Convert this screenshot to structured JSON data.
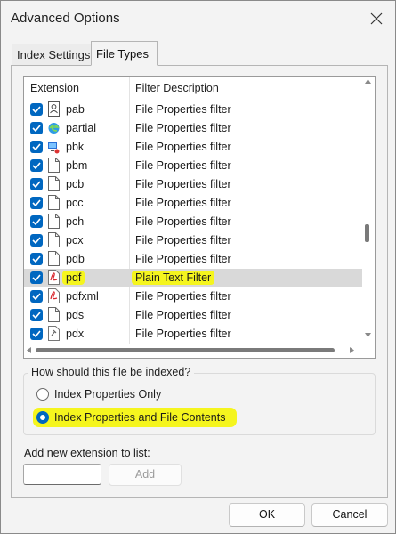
{
  "window": {
    "title": "Advanced Options"
  },
  "tabs": [
    {
      "label": "Index Settings",
      "active": false
    },
    {
      "label": "File Types",
      "active": true
    }
  ],
  "list": {
    "columns": {
      "extension": "Extension",
      "description": "Filter Description"
    },
    "rows": [
      {
        "ext": "pab",
        "desc": "File Properties filter",
        "icon": "contact-card-icon",
        "checked": true
      },
      {
        "ext": "partial",
        "desc": "File Properties filter",
        "icon": "edge-browser-icon",
        "checked": true
      },
      {
        "ext": "pbk",
        "desc": "File Properties filter",
        "icon": "network-phonebook-icon",
        "checked": true
      },
      {
        "ext": "pbm",
        "desc": "File Properties filter",
        "icon": "blank-file-icon",
        "checked": true
      },
      {
        "ext": "pcb",
        "desc": "File Properties filter",
        "icon": "blank-file-icon",
        "checked": true
      },
      {
        "ext": "pcc",
        "desc": "File Properties filter",
        "icon": "blank-file-icon",
        "checked": true
      },
      {
        "ext": "pch",
        "desc": "File Properties filter",
        "icon": "blank-file-icon",
        "checked": true
      },
      {
        "ext": "pcx",
        "desc": "File Properties filter",
        "icon": "blank-file-icon",
        "checked": true
      },
      {
        "ext": "pdb",
        "desc": "File Properties filter",
        "icon": "blank-file-icon",
        "checked": true
      },
      {
        "ext": "pdf",
        "desc": "Plain Text Filter",
        "icon": "pdf-file-icon",
        "checked": true,
        "selected": true
      },
      {
        "ext": "pdfxml",
        "desc": "File Properties filter",
        "icon": "pdf-file-icon",
        "checked": true
      },
      {
        "ext": "pds",
        "desc": "File Properties filter",
        "icon": "blank-file-icon",
        "checked": true
      },
      {
        "ext": "pdx",
        "desc": "File Properties filter",
        "icon": "pdx-file-icon",
        "checked": true
      }
    ]
  },
  "index_group": {
    "label": "How should this file be indexed?",
    "option_properties_only": "Index Properties Only",
    "option_properties_contents": "Index Properties and File Contents",
    "selected": "Index Properties and File Contents"
  },
  "add_extension": {
    "label": "Add new extension to list:",
    "value": "",
    "button": "Add"
  },
  "footer": {
    "ok": "OK",
    "cancel": "Cancel"
  },
  "colors": {
    "accent": "#0067c0",
    "highlight": "#f5f51e",
    "selected_row": "#d9d9d9"
  }
}
